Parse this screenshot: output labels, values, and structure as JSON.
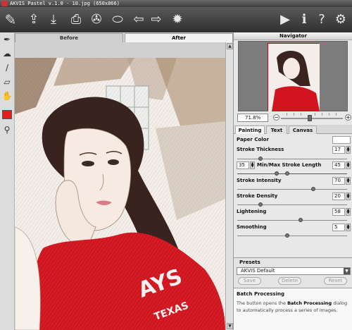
{
  "window": {
    "title": "AKVIS Pastel v.1.0 - 10.jpg (650x866)"
  },
  "toolbar": {
    "items": [
      {
        "name": "logo-brush-icon",
        "glyph": "✎"
      },
      {
        "name": "open-icon",
        "glyph": "⇪"
      },
      {
        "name": "save-icon",
        "glyph": "⤓"
      },
      {
        "name": "print-icon",
        "glyph": "⎙"
      },
      {
        "name": "share-icon",
        "glyph": "✇"
      },
      {
        "name": "plugin-icon",
        "glyph": "⬭"
      },
      {
        "name": "undo-arrow-icon",
        "glyph": "⇦"
      },
      {
        "name": "redo-arrow-icon",
        "glyph": "⇨"
      },
      {
        "name": "settings-gear-icon",
        "glyph": "✹"
      },
      {
        "name": "run-icon",
        "glyph": "▶"
      },
      {
        "name": "info-icon",
        "glyph": "ℹ"
      },
      {
        "name": "help-icon",
        "glyph": "?"
      },
      {
        "name": "preferences-gear-icon",
        "glyph": "⚙"
      }
    ]
  },
  "left_tools": [
    {
      "name": "pastel-brush-icon",
      "glyph": "✒"
    },
    {
      "name": "smudge-tool-icon",
      "glyph": "☁"
    },
    {
      "name": "pencil-tool-icon",
      "glyph": "∕"
    },
    {
      "name": "eraser-tool-icon",
      "glyph": "▱"
    },
    {
      "name": "hand-tool-icon",
      "glyph": "✋"
    },
    {
      "name": "zoom-tool-icon",
      "glyph": "⚲"
    }
  ],
  "view_tabs": {
    "before": "Before",
    "after": "After"
  },
  "navigator": {
    "title": "Navigator",
    "zoom": "71.8%",
    "minus": "−",
    "plus": "+"
  },
  "settings_tabs": {
    "painting": "Painting",
    "text": "Text",
    "canvas": "Canvas"
  },
  "settings": {
    "paper_color_label": "Paper Color",
    "stroke_thickness": {
      "label": "Stroke Thickness",
      "value": "17",
      "level": 0.2
    },
    "stroke_length": {
      "label": "Min/Max Stroke Length",
      "min": "35",
      "max": "45",
      "min_level": 0.35,
      "max_level": 0.45
    },
    "stroke_intensity": {
      "label": "Stroke Intensity",
      "value": "70",
      "level": 0.7
    },
    "stroke_density": {
      "label": "Stroke Density",
      "value": "20",
      "level": 0.2
    },
    "lightening": {
      "label": "Lightening",
      "value": "58",
      "level": 0.58
    },
    "smoothing": {
      "label": "Smoothing",
      "value": "5",
      "level": 0.45
    }
  },
  "presets": {
    "title": "Presets",
    "selected": "AKVIS Default",
    "save": "Save",
    "delete": "Delete",
    "reset": "Reset"
  },
  "batch": {
    "title": "Batch Processing",
    "text_before": "The button opens the ",
    "text_bold": "Batch Processing",
    "text_after": " dialog to automatically process a series of images."
  },
  "colors": {
    "foreground_swatch": "#e51d1d",
    "toolbar": "#3e3e3e",
    "accent_red": "#d2141f"
  }
}
